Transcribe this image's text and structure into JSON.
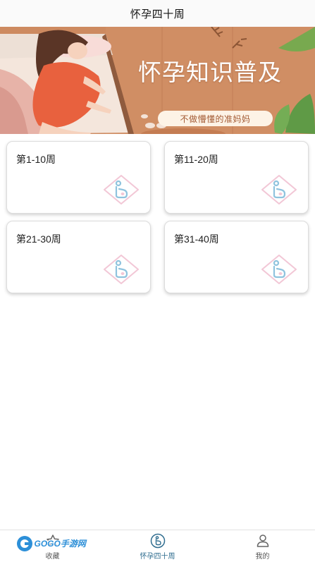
{
  "navbar": {
    "title": "怀孕四十周"
  },
  "banner": {
    "title": "怀孕知识普及",
    "subtitle": "不做懵懂的准妈妈"
  },
  "cards": [
    {
      "label": "第1-10周",
      "icon": "pregnancy-icon"
    },
    {
      "label": "第11-20周",
      "icon": "pregnancy-icon"
    },
    {
      "label": "第21-30周",
      "icon": "pregnancy-icon"
    },
    {
      "label": "第31-40周",
      "icon": "pregnancy-icon"
    }
  ],
  "tabbar": {
    "items": [
      {
        "label": "收藏",
        "icon": "collect-icon",
        "active": false
      },
      {
        "label": "怀孕四十周",
        "icon": "pregnancy-icon",
        "active": true
      },
      {
        "label": "我的",
        "icon": "profile-icon",
        "active": false
      }
    ]
  },
  "watermark": {
    "text": "GOGO手游网"
  },
  "colors": {
    "accent": "#2f6d8f",
    "banner_bg": "#cf8c62",
    "icon_blue": "#8fc3de",
    "icon_pink": "#f2c7d6"
  }
}
